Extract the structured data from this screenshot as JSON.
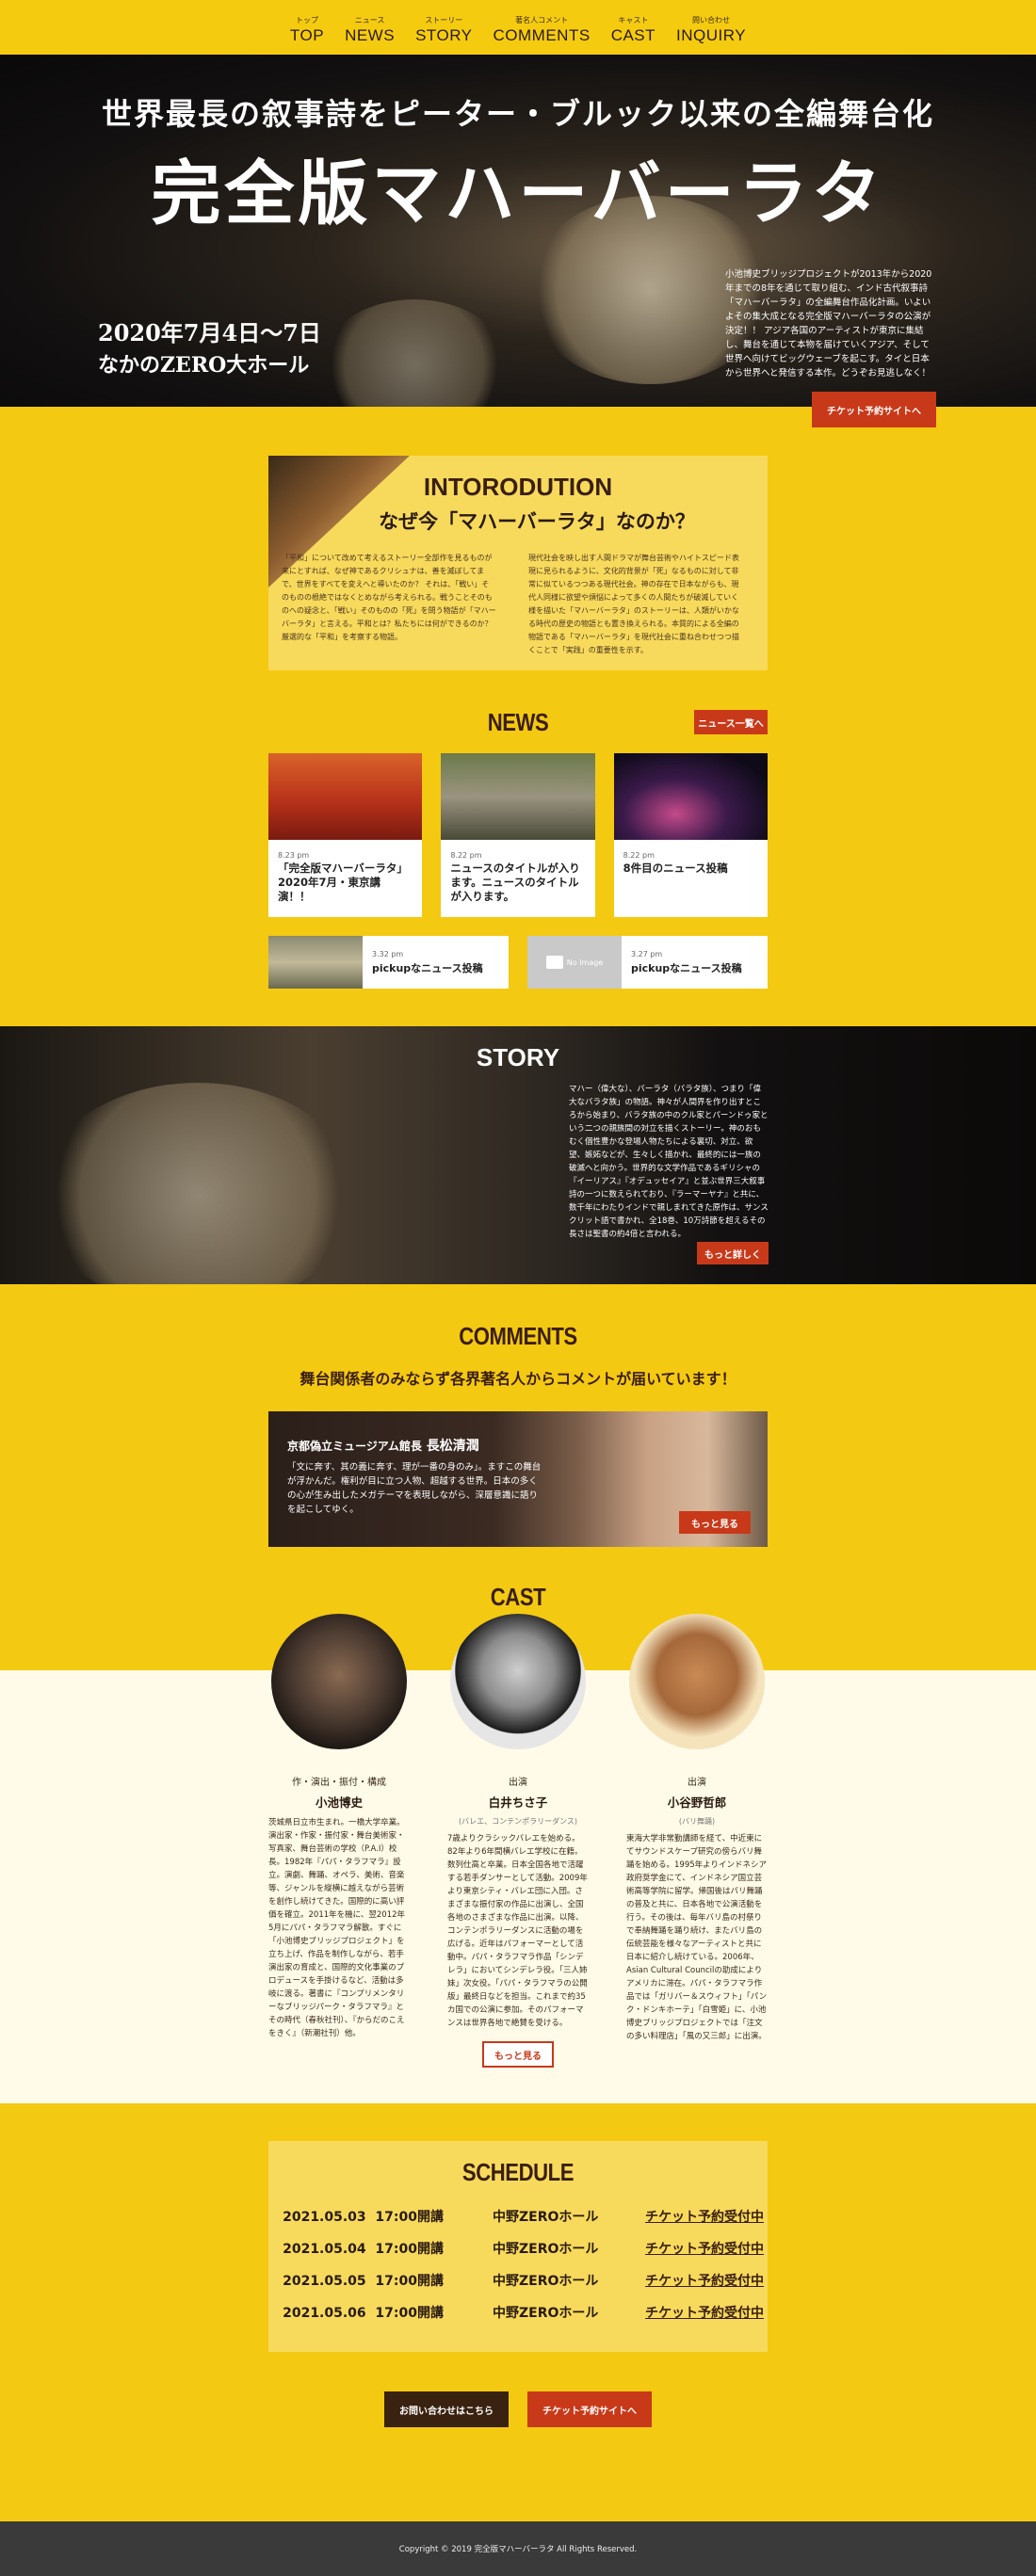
{
  "nav": {
    "items": [
      {
        "sub": "トップ",
        "label": "TOP"
      },
      {
        "sub": "ニュース",
        "label": "NEWS"
      },
      {
        "sub": "ストーリー",
        "label": "STORY"
      },
      {
        "sub": "著名人コメント",
        "label": "COMMENTS"
      },
      {
        "sub": "キャスト",
        "label": "CAST"
      },
      {
        "sub": "問い合わせ",
        "label": "INQUIRY"
      }
    ]
  },
  "hero": {
    "tagline": "世界最長の叙事詩をピーター・ブルック以来の全編舞台化",
    "title": "完全版マハーバーラタ",
    "date": "2020年7月4日〜7日",
    "venue": "なかのZERO大ホール",
    "description": "小池博史ブリッジプロジェクトが2013年から2020年までの8年を通じて取り組む、インド古代叙事詩「マハーバーラタ」の全編舞台作品化計画。いよいよその集大成となる完全版マハーバーラタの公演が決定！！ アジア各国のアーティストが東京に集結し、舞台を通じて本物を届けていくアジア、そして世界へ向けてビッグウェーブを起こす。タイと日本から世界へと発信する本作。どうぞお見逃しなく！",
    "ticket_button": "チケット予約サイトへ"
  },
  "intro": {
    "title": "INTORODUTION",
    "subtitle": "なぜ今「マハーバーラタ」なのか？",
    "col1": "「平和」について改めて考えるストーリー全部作を見るものが来にとすれば、なぜ神であるクリシュナは、善を滅ぼしてまで、世界をすべてを変えへと導いたのか？ それは、「戦い」そのものの根絶ではなくとめながら考えられる。戦うことそのものへの疑念と、「戦い」そのものの「死」を問う物語が「マハーバーラタ」と言える。平和とは？私たちには何ができるのか？厳選的な「平和」を考察する物語。",
    "col2": "現代社会を映し出す人間ドラマが舞台芸術やハイトスピード表現に見られるように、文化的背景が「死」なるものに対して非常に似ているつつある現代社会。神の存在で日本ながらも、現代人同様に欲望や煩悩によって多くの人間たちが破滅していく様を描いた「マハーバーラタ」のストーリーは、人類がいかなる時代の歴史の物語とも置き換えられる。本質的による全編の物語である「マハーバーラタ」を現代社会に重ね合わせつつ描くことで「実践」の重要性を示す。"
  },
  "news": {
    "title": "NEWS",
    "all_button": "ニュース一覧へ",
    "cards": [
      {
        "date": "8.23 pm",
        "title": "「完全版マハーバーラタ」2020年7月・東京講演！！"
      },
      {
        "date": "8.22 pm",
        "title": "ニュースのタイトルが入ります。ニュースのタイトルが入ります。"
      },
      {
        "date": "8.22 pm",
        "title": "8件目のニュース投稿"
      }
    ],
    "pickups": [
      {
        "date": "3.32 pm",
        "title": "pickupなニュース投稿",
        "thumb_text": ""
      },
      {
        "date": "3.27 pm",
        "title": "pickupなニュース投稿",
        "thumb_text": "No Image"
      }
    ]
  },
  "story": {
    "title": "STORY",
    "text": "マハー（偉大な）、バーラタ（バラタ族）、つまり「偉大なバラタ族」の物語。神々が人間界を作り出すところから始まり、バラタ族の中のクル家とパーンドゥ家という二つの親族間の対立を描くストーリー。神のおもむく個性豊かな登場人物たちによる裏切、対立、欲望、嫉妬などが、生々しく描かれ、最終的には一族の破滅へと向かう。世界的な文学作品であるギリシャの『イーリアス』『オデュッセイア』と並ぶ世界三大叙事詩の一つに数えられており、『ラーマーヤナ』と共に、数千年にわたりインドで親しまれてきた原作は、サンスクリット語で書かれ、全18巻、10万詩節を超えるその長さは聖書の約4倍と言われる。",
    "more_button": "もっと詳しく"
  },
  "comments": {
    "title": "COMMENTS",
    "lead": "舞台関係者のみならず各界著名人からコメントが届いています！",
    "card_role": "京都偽立ミュージアム館長",
    "card_name": "長松清潤",
    "card_text": "「文に奔す、其の義に奔す、理が一番の身のみ」。ますこの舞台が浮かんだ。権利が目に立つ人物、超越する世界。日本の多くの心が生み出したメガテーマを表現しながら、深層意識に語りを起こしてゆく。",
    "more_button": "もっと見る"
  },
  "cast": {
    "title": "CAST",
    "members": [
      {
        "role": "作・演出・振付・構成",
        "name": "小池博史",
        "sub": "",
        "bio": "茨城県日立市生まれ。一橋大学卒業。演出家・作家・振付家・舞台美術家・写真家、舞台芸術の学校（P.A.I）校長。1982年『パパ・タラフマラ』設立。演劇、舞踊、オペラ、美術、音楽等、ジャンルを縦横に越えながら芸術を創作し続けてきた。国際的に高い評価を確立。2011年を機に、翌2012年5月にパパ・タラフマラ解散。すぐに「小池博史ブリッジプロジェクト」を立ち上げ、作品を制作しながら、若手演出家の育成と、国際的文化事業のプロデュースを手掛けるなど、活動は多岐に渡る。著書に『コンプリメンタリーなブリッジパーク・タラフマラ』とその時代（春秋社刊）、『からだのこえをきく』（新潮社刊）他。"
      },
      {
        "role": "出演",
        "name": "白井ちさ子",
        "sub": "(バレエ、コンテンポラリーダンス)",
        "bio": "7歳よりクラシックバレエを始める。82年より6年間横バレエ学校に在籍。数列仕高と卒業。日本全国各地で活躍する若手ダンサーとして活動。2009年より東京シティ・バレエ団に入団。さまざまな振付家の作品に出演し、全国各地のさまざまな作品に出演。以降、コンテンポラリーダンスに活動の場を広げる。近年はパフォーマーとして活動中。パパ・タラフマラ作品「シンデレラ」においてシンデレラ役。「三人姉妹」次女役。「パパ・タラフマラの公開版」最終日などを担当。これまで約35カ国での公演に参加。そのパフォーマンスは世界各地で絶賛を受ける。"
      },
      {
        "role": "出演",
        "name": "小谷野哲郎",
        "sub": "(バリ舞踊)",
        "bio": "東海大学非常勤講師を経て、中近東にてサウンドスケープ研究の傍らバリ舞踊を始める。1995年よりインドネシア政府奨学金にて、インドネシア国立芸術高等学院に留学。帰国後はバリ舞踊の普及と共に、日本各地で公演活動を行う。その後は、毎年バリ島の村祭りで奉納舞踊を踊り続け、またバリ島の伝統芸能を様々なアーティストと共に日本に紹介し続けている。2006年、Asian Cultural Councilの助成によりアメリカに滞在。パパ・タラフマラ作品では「ガリバー＆スウィフト」「パンク・ドンキホーテ」「白雪姫」に、小池博史ブリッジプロジェクトでは「注文の多い料理店」「風の又三郎」に出演。"
      }
    ],
    "more_button": "もっと見る"
  },
  "schedule": {
    "title": "SCHEDULE",
    "rows": [
      {
        "date": "2021.05.03",
        "time": "17:00開講",
        "venue": "中野ZEROホール",
        "link": "チケット予約受付中"
      },
      {
        "date": "2021.05.04",
        "time": "17:00開講",
        "venue": "中野ZEROホール",
        "link": "チケット予約受付中"
      },
      {
        "date": "2021.05.05",
        "time": "17:00開講",
        "venue": "中野ZEROホール",
        "link": "チケット予約受付中"
      },
      {
        "date": "2021.05.06",
        "time": "17:00開講",
        "venue": "中野ZEROホール",
        "link": "チケット予約受付中"
      }
    ]
  },
  "cta": {
    "inquiry": "お問い合わせはこちら",
    "ticket": "チケット予約サイトへ"
  },
  "footer": {
    "copyright": "Copyright © 2019 完全版マハーバーラタ All Rights Reserved."
  },
  "colors": {
    "background": "#f4c911",
    "accent_red": "#c8391a",
    "dark_brown": "#3a2210"
  }
}
